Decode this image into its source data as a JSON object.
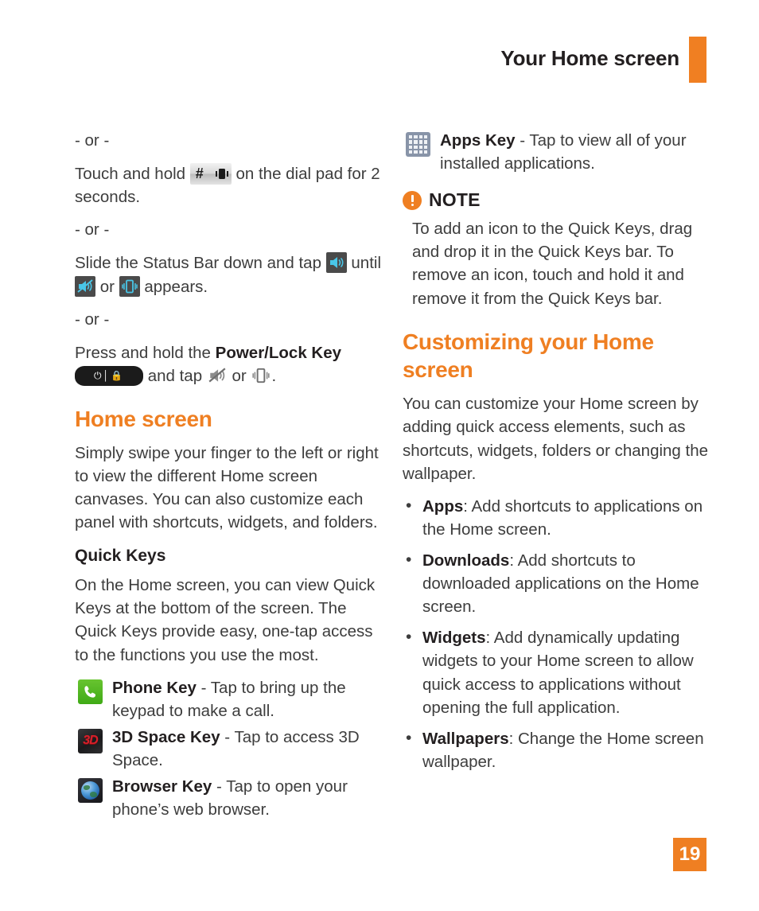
{
  "header": {
    "title": "Your Home screen",
    "accent_color": "#f07f22"
  },
  "page_number": "19",
  "left_column": {
    "or_1": "- or -",
    "touch_hold_pre": "Touch and hold",
    "touch_hold_post": "on the dial pad for 2 seconds.",
    "or_2": "- or -",
    "slide_pre": "Slide the Status Bar down and tap",
    "slide_mid": "until",
    "slide_or": "or",
    "slide_post": "appears.",
    "or_3": "- or -",
    "press_hold_pre": "Press and hold the",
    "press_hold_bold": "Power/Lock Key",
    "press_hold_and_tap": "and tap",
    "press_hold_or": "or",
    "press_hold_end": ".",
    "home_screen_heading": "Home screen",
    "home_screen_body": "Simply swipe your finger to the left or right to view the different Home screen canvases. You can also customize each panel with shortcuts, widgets, and folders.",
    "quick_keys_heading": "Quick Keys",
    "quick_keys_body": "On the Home screen, you can view Quick Keys at the bottom of the screen. The Quick Keys provide easy, one-tap access to the functions you use the most.",
    "keys": [
      {
        "icon": "phone-key-icon",
        "label": "Phone Key",
        "description": " - Tap to bring up the keypad to make a call."
      },
      {
        "icon": "3d-space-key-icon",
        "label": "3D Space Key",
        "description": " - Tap to access 3D Space."
      },
      {
        "icon": "browser-key-icon",
        "label": "Browser Key",
        "description": " - Tap to open your phone’s web browser."
      }
    ]
  },
  "right_column": {
    "apps_key": {
      "icon": "apps-key-icon",
      "label": "Apps Key",
      "description": " - Tap to view all of your installed applications."
    },
    "note": {
      "label": "NOTE",
      "body": "To add an icon to the Quick Keys, drag and drop it in the Quick Keys bar. To remove an icon, touch and hold it and remove it from the Quick Keys bar."
    },
    "customizing_heading": "Customizing your Home screen",
    "customizing_body": "You can customize your Home screen by adding quick access elements, such as shortcuts, widgets, folders or changing the wallpaper.",
    "bullets": [
      {
        "term": "Apps",
        "text": ": Add shortcuts to applications on the Home screen."
      },
      {
        "term": "Downloads",
        "text": ": Add shortcuts to downloaded applications on the Home screen."
      },
      {
        "term": "Widgets",
        "text": ": Add dynamically updating widgets to your Home screen to allow quick access to applications without opening the full application."
      },
      {
        "term": "Wallpapers",
        "text": ": Change the Home screen wallpaper."
      }
    ]
  },
  "icons": {
    "hash_key": "#",
    "power_lock_glyphs": "⏻│🔒"
  }
}
